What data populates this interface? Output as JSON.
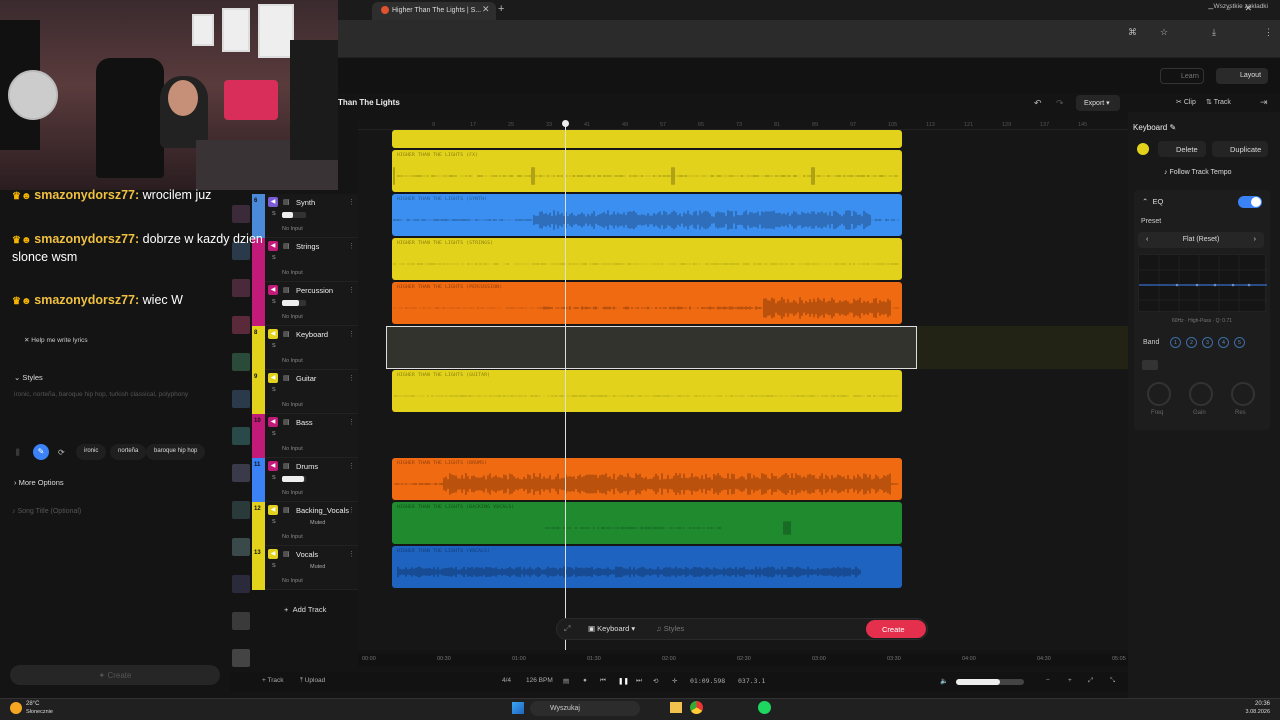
{
  "browser": {
    "tab_title": "Higher Than The Lights | S...",
    "bookmarks_label": "Wszystkie zakładki"
  },
  "header": {
    "learn": "Learn",
    "layout": "Layout",
    "song_title": "Than The Lights",
    "export": "Export",
    "clip_tab": "Clip",
    "track_tab": "Track"
  },
  "chat": [
    {
      "name": "smazonydorsz77:",
      "msg": "wrocilem juz"
    },
    {
      "name": "smazonydorsz77:",
      "msg": "dobrze w kazdy dzien slonce wsm"
    },
    {
      "name": "smazonydorsz77:",
      "msg": "wiec W"
    }
  ],
  "leftpanel": {
    "help_lyrics": "Help me write lyrics",
    "styles_heading": "Styles",
    "styles_text": "ironic, norteña, baroque hip hop, turkish classical, polyphony",
    "chips": [
      "ironic",
      "norteña",
      "baroque hip hop"
    ],
    "more_options": "More Options",
    "song_title_placeholder": "Song Title (Optional)",
    "create": "Create"
  },
  "tracks": [
    {
      "num": "6",
      "name": "Synth",
      "color": "#4a8ad8",
      "mute_color": "#7c5cd6",
      "input": "No Input",
      "vol": 0.45,
      "muted": ""
    },
    {
      "num": "",
      "name": "Strings",
      "color": "#c21a78",
      "mute_color": "#c21a78",
      "input": "No Input",
      "vol": 0,
      "muted": ""
    },
    {
      "num": "",
      "name": "Percussion",
      "color": "#c21a78",
      "mute_color": "#c21a78",
      "input": "No Input",
      "vol": 0.7,
      "muted": ""
    },
    {
      "num": "8",
      "name": "Keyboard",
      "color": "#e2d21b",
      "mute_color": "#e2d21b",
      "input": "No Input",
      "vol": 0,
      "muted": ""
    },
    {
      "num": "9",
      "name": "Guitar",
      "color": "#e2d21b",
      "mute_color": "#e2d21b",
      "input": "No Input",
      "vol": 0,
      "muted": ""
    },
    {
      "num": "10",
      "name": "Bass",
      "color": "#c21a78",
      "mute_color": "#c21a78",
      "input": "No Input",
      "vol": 0,
      "muted": ""
    },
    {
      "num": "11",
      "name": "Drums",
      "color": "#3b82f6",
      "mute_color": "#c21a78",
      "input": "No Input",
      "vol": 0.9,
      "muted": ""
    },
    {
      "num": "12",
      "name": "Backing_Vocals",
      "color": "#e2d21b",
      "mute_color": "#e2d21b",
      "input": "No Input",
      "vol": 0,
      "muted": "Muted"
    },
    {
      "num": "13",
      "name": "Vocals",
      "color": "#e2d21b",
      "mute_color": "#e2d21b",
      "input": "No Input",
      "vol": 0,
      "muted": "Muted"
    }
  ],
  "add_track": "Add Track",
  "clips": [
    {
      "label": "",
      "color": "#e2d21b"
    },
    {
      "label": "HIGHER THAN THE LIGHTS (FX)",
      "color": "#e2d21b"
    },
    {
      "label": "HIGHER THAN THE LIGHTS (SYNTH)",
      "color": "#3b8ff0"
    },
    {
      "label": "HIGHER THAN THE LIGHTS (STRINGS)",
      "color": "#e2d21b"
    },
    {
      "label": "HIGHER THAN THE LIGHTS (PERCUSSION)",
      "color": "#f06a12"
    },
    {
      "label": "HIGHER THAN THE LIGHTS (GUITAR)",
      "color": "#e2d21b"
    },
    {
      "label": "HIGHER THAN THE LIGHTS (DRUMS)",
      "color": "#f06a12"
    },
    {
      "label": "HIGHER THAN THE LIGHTS (BACKING VOCALS)",
      "color": "#1f8a2e"
    },
    {
      "label": "HIGHER THAN THE LIGHTS (VOCALS)",
      "color": "#1e63c0"
    }
  ],
  "ruler_marks": [
    "9",
    "17",
    "25",
    "33",
    "41",
    "49",
    "57",
    "65",
    "73",
    "81",
    "89",
    "97",
    "105",
    "113",
    "121",
    "129",
    "137",
    "145"
  ],
  "bottom_timeline": [
    "00:00",
    "00:30",
    "01:00",
    "01:30",
    "02:00",
    "02:30",
    "03:00",
    "03:30",
    "04:00",
    "04:30",
    "05:05"
  ],
  "transport": {
    "track": "Track",
    "upload": "Upload",
    "signature": "4/4",
    "bpm": "126 BPM",
    "time": "01:09.598",
    "position": "037.3.1"
  },
  "prompt": {
    "instrument": "Keyboard",
    "styles": "Styles",
    "create": "Create"
  },
  "rightpanel": {
    "title": "Keyboard",
    "delete": "Delete",
    "duplicate": "Duplicate",
    "follow_tempo": "Follow Track Tempo",
    "eq": "EQ",
    "preset_label": "Preset",
    "preset_value": "Flat (Reset)",
    "eq_info": "60Hz · High-Pass · Q: 0.71",
    "band_label": "Band",
    "bands": [
      "1",
      "2",
      "3",
      "4",
      "5"
    ],
    "knobs": [
      "Freq",
      "Gain",
      "Res"
    ]
  },
  "taskbar": {
    "search": "Wyszukaj",
    "weather_temp": "28°C",
    "weather_desc": "Słonecznie",
    "time": "20:36",
    "date": "3.08.2026"
  }
}
